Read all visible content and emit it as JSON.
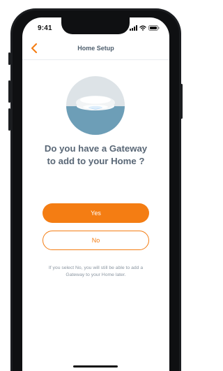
{
  "status_bar": {
    "time": "9:41",
    "icons": [
      "signal-icon",
      "wifi-icon",
      "battery-icon"
    ]
  },
  "nav": {
    "title": "Home Setup",
    "back_icon": "chevron-left-icon"
  },
  "illustration": {
    "icon": "gateway-device-icon"
  },
  "content": {
    "question_line_1": "Do you have a Gateway",
    "question_line_2": "to add to your Home ?",
    "yes_label": "Yes",
    "no_label": "No",
    "hint_line_1": "If you select No, you will still be able to add a",
    "hint_line_2": "Gateway to your Home later."
  },
  "colors": {
    "accent": "#f47d13",
    "text_primary": "#596776",
    "text_secondary": "#8b96a1"
  }
}
